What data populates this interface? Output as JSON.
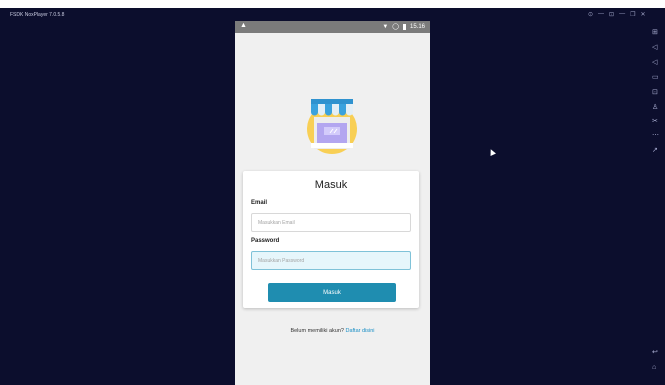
{
  "window": {
    "title": "FSDK NoxPlayer 7.0.5.8",
    "controls": [
      "⊙",
      "—",
      "⊡",
      "—",
      "❐",
      "✕",
      "⛶"
    ]
  },
  "toolbar": {
    "icons": [
      "screenshot-icon",
      "volume-up-icon",
      "volume-down-icon",
      "screen-icon",
      "apk-icon",
      "shake-icon",
      "scissors-icon",
      "more-icon",
      "share-icon",
      "back-icon",
      "home-icon"
    ],
    "glyphs": [
      "⊞",
      "◁",
      "◁",
      "▭",
      "⊡",
      "♙",
      "✂",
      "⋯",
      "↗",
      "↩",
      "⌂"
    ]
  },
  "status_bar": {
    "left_icon": "▲",
    "time": "15.16",
    "wifi": "▼",
    "signal": "◯"
  },
  "login": {
    "title": "Masuk",
    "email_label": "Email",
    "email_placeholder": "Masukkan Email",
    "password_label": "Password",
    "password_placeholder": "Masukkan Password",
    "submit_label": "Masuk",
    "footer_text": "Belum memiliki akun?",
    "register_link": "Daftar disini"
  },
  "colors": {
    "emulator_bg": "#0c0e2d",
    "accent": "#1f8db0",
    "link": "#1a8fc6",
    "awning_blue": "#3aa2de",
    "logo_circle": "#f8cf55"
  }
}
